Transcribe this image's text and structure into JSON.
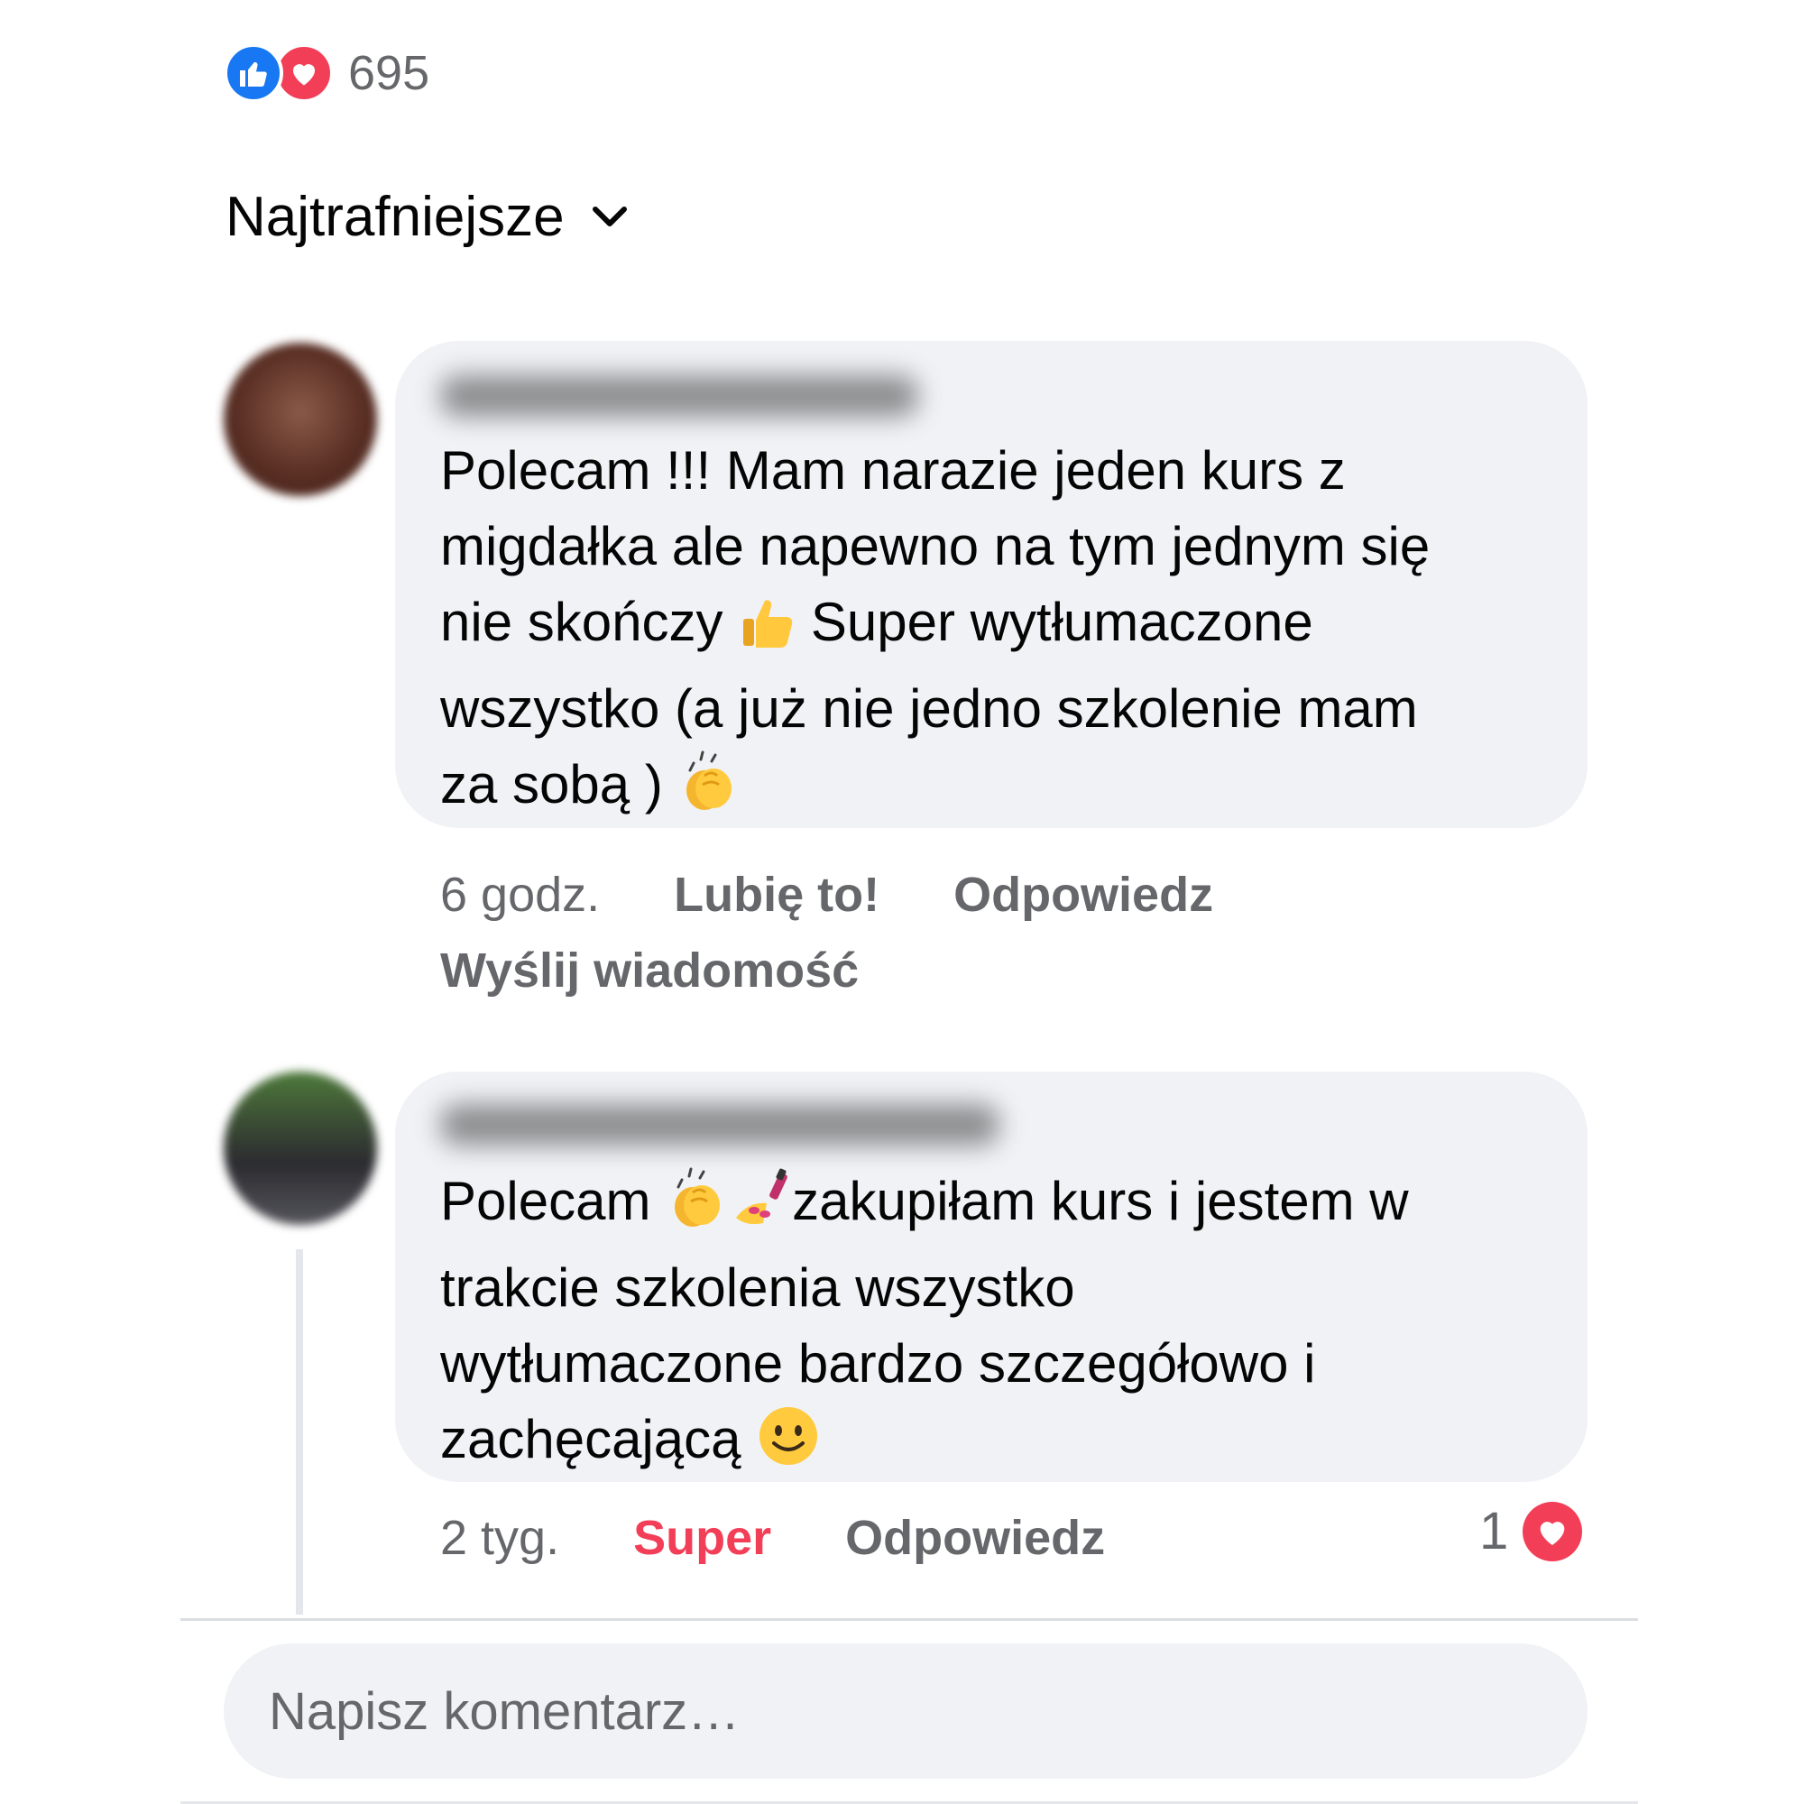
{
  "reactions": {
    "count": "695",
    "types": [
      "like-icon",
      "love-icon"
    ],
    "like_color": "#1877f2",
    "love_color": "#f33e58"
  },
  "sort": {
    "label": "Najtrafniejsze"
  },
  "comments": [
    {
      "author": "",
      "text_lines": [
        "Polecam !!! Mam narazie jeden kurs z",
        "migdałka ale napewno na tym jednym się",
        "nie skończy ",
        " Super wytłumaczone",
        "wszystko (a już nie jedno szkolenie mam",
        "za sobą ) "
      ],
      "emojis": [
        "thumbs-up-emoji",
        "clapping-hands-emoji"
      ],
      "time": "6 godz.",
      "like_label": "Lubię to!",
      "reply_label": "Odpowiedz",
      "message_label": "Wyślij wiadomość"
    },
    {
      "author": "",
      "text_lines": [
        "Polecam ",
        "zakupiłam kurs i jestem w",
        "trakcie  szkolenia wszystko",
        "wytłumaczone bardzo szczegółowo i",
        "zachęcającą "
      ],
      "emojis": [
        "clapping-hands-emoji",
        "nail-polish-emoji",
        "smiling-face-emoji"
      ],
      "time": "2 tyg.",
      "reaction_label": "Super",
      "reaction_color": "#f33e58",
      "reply_label": "Odpowiedz",
      "reaction_count": "1"
    }
  ],
  "composer": {
    "placeholder": "Napisz komentarz…"
  }
}
